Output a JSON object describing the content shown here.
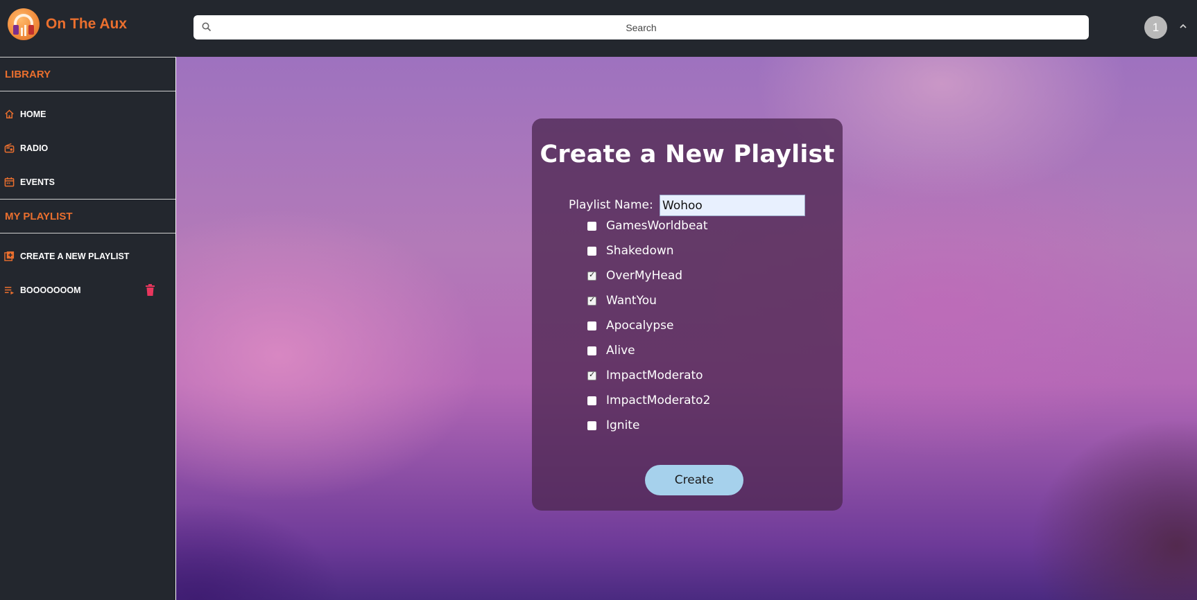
{
  "app": {
    "title": "On The Aux",
    "logo_icon": "headphones-logo-icon"
  },
  "search": {
    "placeholder": "Search",
    "icon": "search-icon"
  },
  "user": {
    "avatar_text": "1"
  },
  "sidebar": {
    "library_heading": "LIBRARY",
    "library_items": [
      {
        "label": "HOME",
        "icon": "home-icon"
      },
      {
        "label": "RADIO",
        "icon": "radio-icon"
      },
      {
        "label": "EVENTS",
        "icon": "calendar-icon"
      }
    ],
    "playlist_heading": "MY PLAYLIST",
    "playlist_items": [
      {
        "label": "CREATE A NEW PLAYLIST",
        "icon": "add-playlist-icon"
      },
      {
        "label": "BOOOOOOOM",
        "icon": "playlist-icon",
        "action_icon": "trash-icon"
      }
    ]
  },
  "form": {
    "title": "Create a New Playlist",
    "name_label": "Playlist Name:",
    "name_value": "Wohoo",
    "songs": [
      {
        "label": "GamesWorldbeat",
        "checked": false
      },
      {
        "label": "Shakedown",
        "checked": false
      },
      {
        "label": "OverMyHead",
        "checked": true
      },
      {
        "label": "WantYou",
        "checked": true
      },
      {
        "label": "Apocalypse",
        "checked": false
      },
      {
        "label": "Alive",
        "checked": false
      },
      {
        "label": "ImpactModerato",
        "checked": true
      },
      {
        "label": "ImpactModerato2",
        "checked": false
      },
      {
        "label": "Ignite",
        "checked": false
      }
    ],
    "submit_label": "Create"
  },
  "colors": {
    "accent": "#ea6f2e",
    "chrome": "#23272e",
    "button": "#a6d1ec",
    "danger": "#e8365d"
  }
}
